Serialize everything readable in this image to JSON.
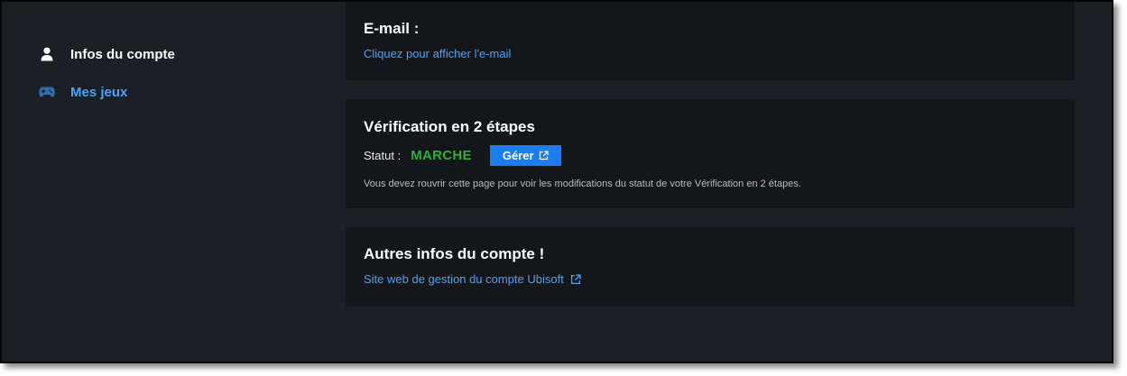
{
  "sidebar": {
    "items": [
      {
        "label": "Infos du compte",
        "icon": "user-icon",
        "active": true
      },
      {
        "label": "Mes jeux",
        "icon": "gamepad-icon",
        "active": false
      }
    ]
  },
  "email": {
    "title": "E-mail :",
    "show_link": "Cliquez pour afficher l'e-mail"
  },
  "two_factor": {
    "title": "Vérification en 2 étapes",
    "status_label": "Statut :",
    "status_value": "MARCHE",
    "manage_label": "Gérer",
    "note": "Vous devez rouvrir cette page pour voir les modifications du statut de votre Vérification en 2 étapes."
  },
  "other": {
    "title": "Autres infos du compte !",
    "link": "Site web de gestion du compte Ubisoft"
  },
  "colors": {
    "background": "#1b1f26",
    "card": "#13161b",
    "accent": "#4aa3f7",
    "button": "#1a7ef2",
    "status_on": "#2bb135"
  }
}
